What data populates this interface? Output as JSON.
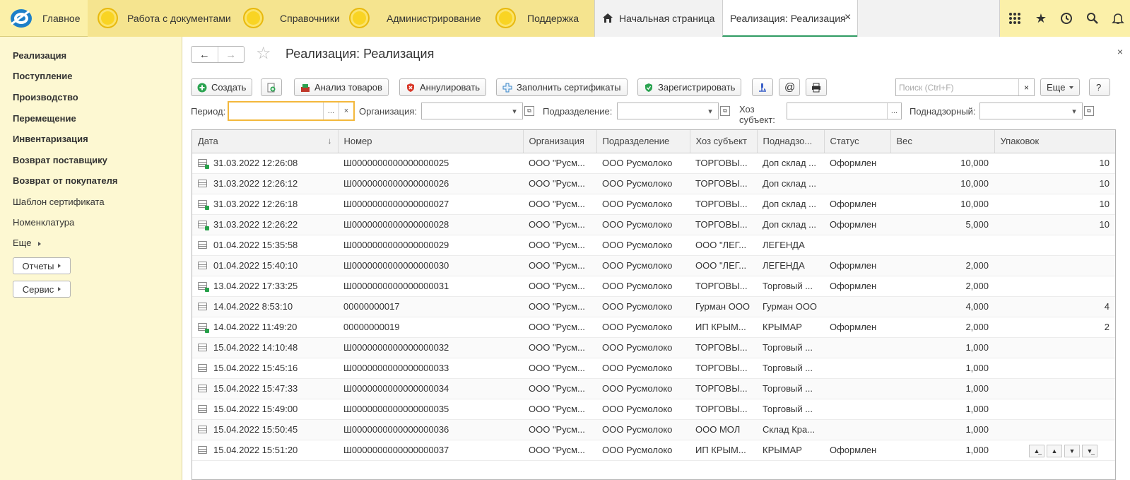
{
  "topbar": {
    "home_label": "Главное",
    "sections": [
      "Работа с документами",
      "Справочники",
      "Администрирование",
      "Поддержка"
    ],
    "tabs": [
      {
        "label": "Начальная страница"
      },
      {
        "label": "Реализация: Реализация",
        "close": "×"
      }
    ],
    "icons": [
      "apps-grid-icon",
      "star-icon",
      "history-icon",
      "search-icon",
      "bell-icon"
    ]
  },
  "sidebar": {
    "items": [
      {
        "label": "Реализация",
        "bold": true
      },
      {
        "label": "Поступление",
        "bold": true
      },
      {
        "label": "Производство",
        "bold": true
      },
      {
        "label": "Перемещение",
        "bold": true
      },
      {
        "label": "Инвентаризация",
        "bold": true
      },
      {
        "label": "Возврат поставщику",
        "bold": true
      },
      {
        "label": "Возврат от покупателя",
        "bold": true
      },
      {
        "label": "Шаблон сертификата",
        "bold": false
      },
      {
        "label": "Номенклатура",
        "bold": false
      },
      {
        "label": "Еще",
        "bold": false
      }
    ],
    "buttons": [
      "Отчеты",
      "Сервис"
    ]
  },
  "form": {
    "title": "Реализация: Реализация",
    "close": "×",
    "toolbar": {
      "create": "Создать",
      "analysis": "Анализ товаров",
      "annul": "Аннулировать",
      "fill_certs": "Заполнить сертификаты",
      "register": "Зарегистрировать",
      "at": "@",
      "search_placeholder": "Поиск (Ctrl+F)",
      "search_clear": "×",
      "more": "Еще",
      "help": "?"
    },
    "filters": {
      "period_label": "Период:",
      "period_value": "",
      "org_label": "Организация:",
      "org_value": "",
      "dept_label": "Подразделение:",
      "dept_value": "",
      "subject_label_1": "Хоз",
      "subject_label_2": "субъект:",
      "subject_value": "",
      "supervised_label": "Поднадзорный:",
      "supervised_value": "",
      "dots": "...",
      "clear": "×"
    }
  },
  "table": {
    "columns": [
      "Дата",
      "Номер",
      "Организация",
      "Подразделение",
      "Хоз субъект",
      "Поднадзо...",
      "Статус",
      "Вес",
      "Упаковок"
    ],
    "sort_indicator": "↓",
    "rows": [
      {
        "posted": true,
        "date": "31.03.2022 12:26:08",
        "number": "Ш0000000000000000025",
        "org": "ООО \"Русм...",
        "dept": "ООО Русмолоко",
        "subject": "ТОРГОВЫ...",
        "supervised": "Доп склад ...",
        "status": "Оформлен",
        "weight": "10,000",
        "packs": "10"
      },
      {
        "posted": false,
        "date": "31.03.2022 12:26:12",
        "number": "Ш0000000000000000026",
        "org": "ООО \"Русм...",
        "dept": "ООО Русмолоко",
        "subject": "ТОРГОВЫ...",
        "supervised": "Доп склад ...",
        "status": "",
        "weight": "10,000",
        "packs": "10"
      },
      {
        "posted": true,
        "date": "31.03.2022 12:26:18",
        "number": "Ш0000000000000000027",
        "org": "ООО \"Русм...",
        "dept": "ООО Русмолоко",
        "subject": "ТОРГОВЫ...",
        "supervised": "Доп склад ...",
        "status": "Оформлен",
        "weight": "10,000",
        "packs": "10"
      },
      {
        "posted": true,
        "date": "31.03.2022 12:26:22",
        "number": "Ш0000000000000000028",
        "org": "ООО \"Русм...",
        "dept": "ООО Русмолоко",
        "subject": "ТОРГОВЫ...",
        "supervised": "Доп склад ...",
        "status": "Оформлен",
        "weight": "5,000",
        "packs": "10"
      },
      {
        "posted": false,
        "date": "01.04.2022 15:35:58",
        "number": "Ш0000000000000000029",
        "org": "ООО \"Русм...",
        "dept": "ООО Русмолоко",
        "subject": "ООО \"ЛЕГ...",
        "supervised": "ЛЕГЕНДА",
        "status": "",
        "weight": "",
        "packs": ""
      },
      {
        "posted": false,
        "date": "01.04.2022 15:40:10",
        "number": "Ш0000000000000000030",
        "org": "ООО \"Русм...",
        "dept": "ООО Русмолоко",
        "subject": "ООО \"ЛЕГ...",
        "supervised": "ЛЕГЕНДА",
        "status": "Оформлен",
        "weight": "2,000",
        "packs": ""
      },
      {
        "posted": true,
        "date": "13.04.2022 17:33:25",
        "number": "Ш0000000000000000031",
        "org": "ООО \"Русм...",
        "dept": "ООО Русмолоко",
        "subject": "ТОРГОВЫ...",
        "supervised": "Торговый ...",
        "status": "Оформлен",
        "weight": "2,000",
        "packs": ""
      },
      {
        "posted": false,
        "date": "14.04.2022 8:53:10",
        "number": "00000000017",
        "org": "ООО \"Русм...",
        "dept": "ООО Русмолоко",
        "subject": "Гурман ООО",
        "supervised": "Гурман ООО",
        "status": "",
        "weight": "4,000",
        "packs": "4"
      },
      {
        "posted": true,
        "date": "14.04.2022 11:49:20",
        "number": "00000000019",
        "org": "ООО \"Русм...",
        "dept": "ООО Русмолоко",
        "subject": " ИП КРЫМ...",
        "supervised": "КРЫМАР",
        "status": "Оформлен",
        "weight": "2,000",
        "packs": "2"
      },
      {
        "posted": false,
        "date": "15.04.2022 14:10:48",
        "number": "Ш0000000000000000032",
        "org": "ООО \"Русм...",
        "dept": "ООО Русмолоко",
        "subject": "ТОРГОВЫ...",
        "supervised": "Торговый ...",
        "status": "",
        "weight": "1,000",
        "packs": ""
      },
      {
        "posted": false,
        "date": "15.04.2022 15:45:16",
        "number": "Ш0000000000000000033",
        "org": "ООО \"Русм...",
        "dept": "ООО Русмолоко",
        "subject": "ТОРГОВЫ...",
        "supervised": "Торговый ...",
        "status": "",
        "weight": "1,000",
        "packs": ""
      },
      {
        "posted": false,
        "date": "15.04.2022 15:47:33",
        "number": "Ш0000000000000000034",
        "org": "ООО \"Русм...",
        "dept": "ООО Русмолоко",
        "subject": "ТОРГОВЫ...",
        "supervised": "Торговый ...",
        "status": "",
        "weight": "1,000",
        "packs": ""
      },
      {
        "posted": false,
        "date": "15.04.2022 15:49:00",
        "number": "Ш0000000000000000035",
        "org": "ООО \"Русм...",
        "dept": "ООО Русмолоко",
        "subject": "ТОРГОВЫ...",
        "supervised": "Торговый ...",
        "status": "",
        "weight": "1,000",
        "packs": ""
      },
      {
        "posted": false,
        "date": "15.04.2022 15:50:45",
        "number": "Ш0000000000000000036",
        "org": "ООО \"Русм...",
        "dept": "ООО Русмолоко",
        "subject": "ООО  МОЛ",
        "supervised": "Склад Кра...",
        "status": "",
        "weight": "1,000",
        "packs": ""
      },
      {
        "posted": false,
        "date": "15.04.2022 15:51:20",
        "number": "Ш0000000000000000037",
        "org": "ООО \"Русм...",
        "dept": "ООО Русмолоко",
        "subject": " ИП КРЫМ...",
        "supervised": "КРЫМАР",
        "status": "Оформлен",
        "weight": "1,000",
        "packs": ""
      }
    ]
  },
  "scroll_buttons": [
    "scroll-top-icon",
    "scroll-up-icon",
    "scroll-down-icon",
    "scroll-bottom-icon"
  ]
}
